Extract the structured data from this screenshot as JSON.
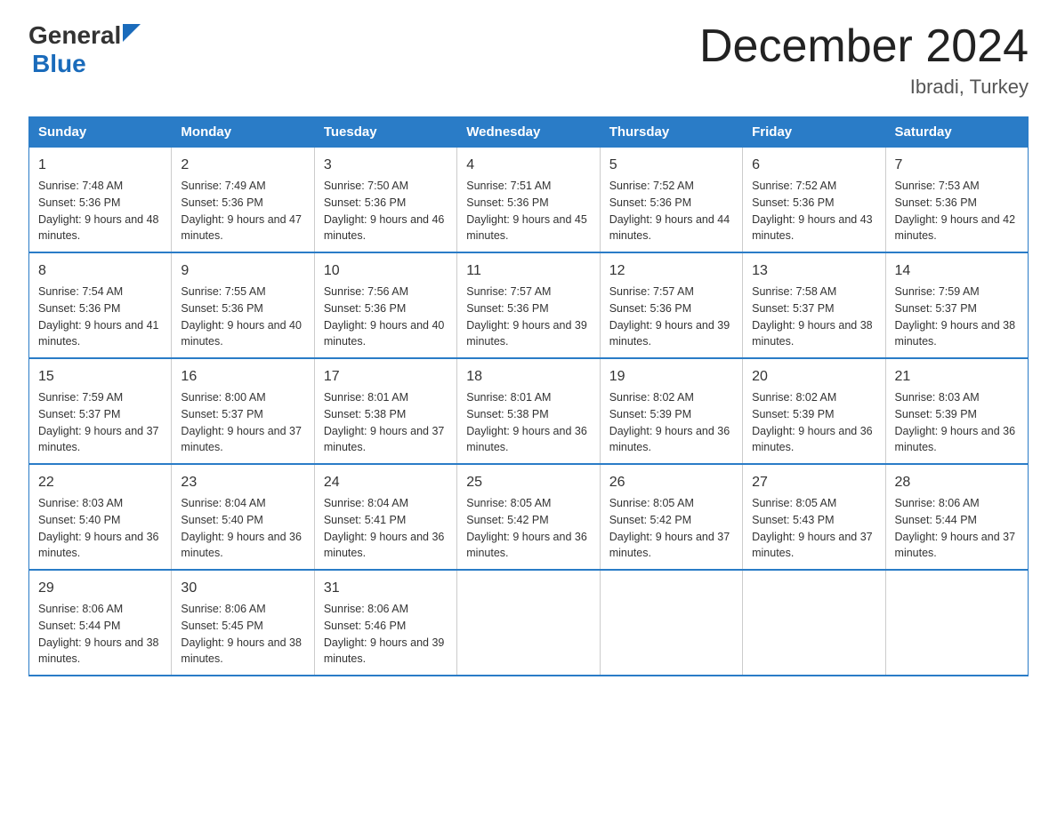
{
  "header": {
    "logo_general": "General",
    "logo_blue": "Blue",
    "month_title": "December 2024",
    "location": "Ibradi, Turkey"
  },
  "weekdays": [
    "Sunday",
    "Monday",
    "Tuesday",
    "Wednesday",
    "Thursday",
    "Friday",
    "Saturday"
  ],
  "weeks": [
    [
      {
        "day": "1",
        "sunrise": "7:48 AM",
        "sunset": "5:36 PM",
        "daylight": "9 hours and 48 minutes."
      },
      {
        "day": "2",
        "sunrise": "7:49 AM",
        "sunset": "5:36 PM",
        "daylight": "9 hours and 47 minutes."
      },
      {
        "day": "3",
        "sunrise": "7:50 AM",
        "sunset": "5:36 PM",
        "daylight": "9 hours and 46 minutes."
      },
      {
        "day": "4",
        "sunrise": "7:51 AM",
        "sunset": "5:36 PM",
        "daylight": "9 hours and 45 minutes."
      },
      {
        "day": "5",
        "sunrise": "7:52 AM",
        "sunset": "5:36 PM",
        "daylight": "9 hours and 44 minutes."
      },
      {
        "day": "6",
        "sunrise": "7:52 AM",
        "sunset": "5:36 PM",
        "daylight": "9 hours and 43 minutes."
      },
      {
        "day": "7",
        "sunrise": "7:53 AM",
        "sunset": "5:36 PM",
        "daylight": "9 hours and 42 minutes."
      }
    ],
    [
      {
        "day": "8",
        "sunrise": "7:54 AM",
        "sunset": "5:36 PM",
        "daylight": "9 hours and 41 minutes."
      },
      {
        "day": "9",
        "sunrise": "7:55 AM",
        "sunset": "5:36 PM",
        "daylight": "9 hours and 40 minutes."
      },
      {
        "day": "10",
        "sunrise": "7:56 AM",
        "sunset": "5:36 PM",
        "daylight": "9 hours and 40 minutes."
      },
      {
        "day": "11",
        "sunrise": "7:57 AM",
        "sunset": "5:36 PM",
        "daylight": "9 hours and 39 minutes."
      },
      {
        "day": "12",
        "sunrise": "7:57 AM",
        "sunset": "5:36 PM",
        "daylight": "9 hours and 39 minutes."
      },
      {
        "day": "13",
        "sunrise": "7:58 AM",
        "sunset": "5:37 PM",
        "daylight": "9 hours and 38 minutes."
      },
      {
        "day": "14",
        "sunrise": "7:59 AM",
        "sunset": "5:37 PM",
        "daylight": "9 hours and 38 minutes."
      }
    ],
    [
      {
        "day": "15",
        "sunrise": "7:59 AM",
        "sunset": "5:37 PM",
        "daylight": "9 hours and 37 minutes."
      },
      {
        "day": "16",
        "sunrise": "8:00 AM",
        "sunset": "5:37 PM",
        "daylight": "9 hours and 37 minutes."
      },
      {
        "day": "17",
        "sunrise": "8:01 AM",
        "sunset": "5:38 PM",
        "daylight": "9 hours and 37 minutes."
      },
      {
        "day": "18",
        "sunrise": "8:01 AM",
        "sunset": "5:38 PM",
        "daylight": "9 hours and 36 minutes."
      },
      {
        "day": "19",
        "sunrise": "8:02 AM",
        "sunset": "5:39 PM",
        "daylight": "9 hours and 36 minutes."
      },
      {
        "day": "20",
        "sunrise": "8:02 AM",
        "sunset": "5:39 PM",
        "daylight": "9 hours and 36 minutes."
      },
      {
        "day": "21",
        "sunrise": "8:03 AM",
        "sunset": "5:39 PM",
        "daylight": "9 hours and 36 minutes."
      }
    ],
    [
      {
        "day": "22",
        "sunrise": "8:03 AM",
        "sunset": "5:40 PM",
        "daylight": "9 hours and 36 minutes."
      },
      {
        "day": "23",
        "sunrise": "8:04 AM",
        "sunset": "5:40 PM",
        "daylight": "9 hours and 36 minutes."
      },
      {
        "day": "24",
        "sunrise": "8:04 AM",
        "sunset": "5:41 PM",
        "daylight": "9 hours and 36 minutes."
      },
      {
        "day": "25",
        "sunrise": "8:05 AM",
        "sunset": "5:42 PM",
        "daylight": "9 hours and 36 minutes."
      },
      {
        "day": "26",
        "sunrise": "8:05 AM",
        "sunset": "5:42 PM",
        "daylight": "9 hours and 37 minutes."
      },
      {
        "day": "27",
        "sunrise": "8:05 AM",
        "sunset": "5:43 PM",
        "daylight": "9 hours and 37 minutes."
      },
      {
        "day": "28",
        "sunrise": "8:06 AM",
        "sunset": "5:44 PM",
        "daylight": "9 hours and 37 minutes."
      }
    ],
    [
      {
        "day": "29",
        "sunrise": "8:06 AM",
        "sunset": "5:44 PM",
        "daylight": "9 hours and 38 minutes."
      },
      {
        "day": "30",
        "sunrise": "8:06 AM",
        "sunset": "5:45 PM",
        "daylight": "9 hours and 38 minutes."
      },
      {
        "day": "31",
        "sunrise": "8:06 AM",
        "sunset": "5:46 PM",
        "daylight": "9 hours and 39 minutes."
      },
      null,
      null,
      null,
      null
    ]
  ]
}
